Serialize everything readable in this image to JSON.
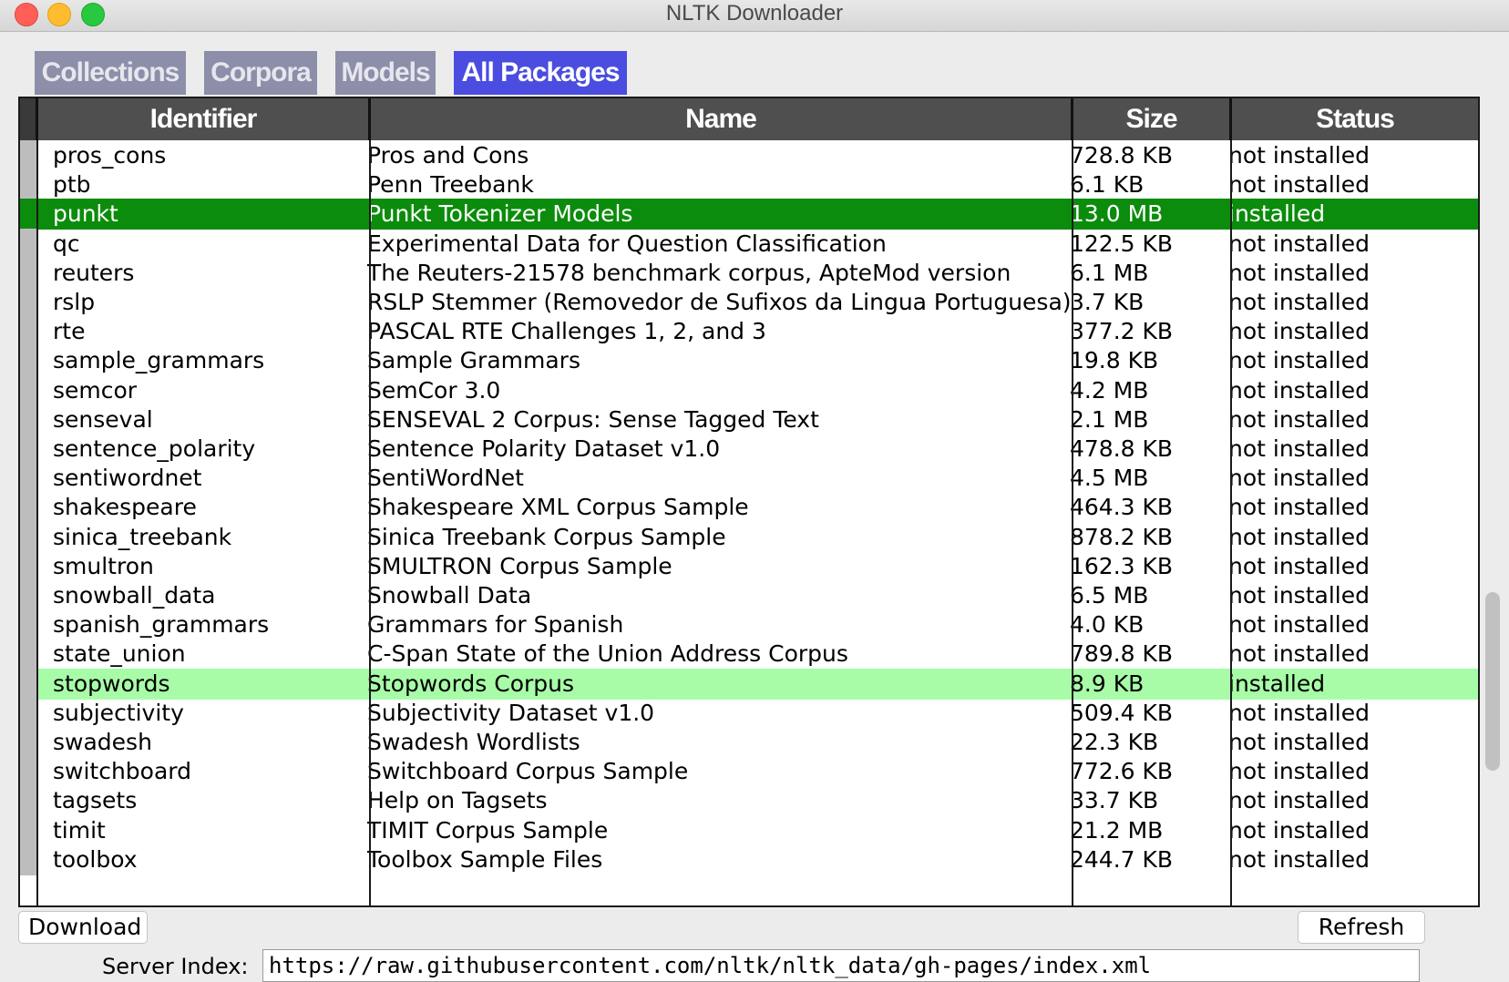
{
  "window": {
    "title": "NLTK Downloader"
  },
  "tabs": [
    {
      "label": "Collections",
      "active": false
    },
    {
      "label": "Corpora",
      "active": false
    },
    {
      "label": "Models",
      "active": false
    },
    {
      "label": "All Packages",
      "active": true
    }
  ],
  "table": {
    "columns": [
      "Identifier",
      "Name",
      "Size",
      "Status"
    ],
    "rows": [
      {
        "id": "pros_cons",
        "name": "Pros and Cons",
        "size": "728.8 KB",
        "status": "not installed",
        "hl": ""
      },
      {
        "id": "ptb",
        "name": "Penn Treebank",
        "size": "6.1 KB",
        "status": "not installed",
        "hl": ""
      },
      {
        "id": "punkt",
        "name": "Punkt Tokenizer Models",
        "size": "13.0 MB",
        "status": "installed",
        "hl": "green"
      },
      {
        "id": "qc",
        "name": "Experimental Data for Question Classification",
        "size": "122.5 KB",
        "status": "not installed",
        "hl": ""
      },
      {
        "id": "reuters",
        "name": "The Reuters-21578 benchmark corpus, ApteMod version",
        "size": "6.1 MB",
        "status": "not installed",
        "hl": ""
      },
      {
        "id": "rslp",
        "name": "RSLP Stemmer (Removedor de Sufixos da Lingua Portuguesa)",
        "size": "3.7 KB",
        "status": "not installed",
        "hl": ""
      },
      {
        "id": "rte",
        "name": "PASCAL RTE Challenges 1, 2, and 3",
        "size": "377.2 KB",
        "status": "not installed",
        "hl": ""
      },
      {
        "id": "sample_grammars",
        "name": "Sample Grammars",
        "size": "19.8 KB",
        "status": "not installed",
        "hl": ""
      },
      {
        "id": "semcor",
        "name": "SemCor 3.0",
        "size": "4.2 MB",
        "status": "not installed",
        "hl": ""
      },
      {
        "id": "senseval",
        "name": "SENSEVAL 2 Corpus: Sense Tagged Text",
        "size": "2.1 MB",
        "status": "not installed",
        "hl": ""
      },
      {
        "id": "sentence_polarity",
        "name": "Sentence Polarity Dataset v1.0",
        "size": "478.8 KB",
        "status": "not installed",
        "hl": ""
      },
      {
        "id": "sentiwordnet",
        "name": "SentiWordNet",
        "size": "4.5 MB",
        "status": "not installed",
        "hl": ""
      },
      {
        "id": "shakespeare",
        "name": "Shakespeare XML Corpus Sample",
        "size": "464.3 KB",
        "status": "not installed",
        "hl": ""
      },
      {
        "id": "sinica_treebank",
        "name": "Sinica Treebank Corpus Sample",
        "size": "878.2 KB",
        "status": "not installed",
        "hl": ""
      },
      {
        "id": "smultron",
        "name": "SMULTRON Corpus Sample",
        "size": "162.3 KB",
        "status": "not installed",
        "hl": ""
      },
      {
        "id": "snowball_data",
        "name": "Snowball Data",
        "size": "6.5 MB",
        "status": "not installed",
        "hl": ""
      },
      {
        "id": "spanish_grammars",
        "name": "Grammars for Spanish",
        "size": "4.0 KB",
        "status": "not installed",
        "hl": ""
      },
      {
        "id": "state_union",
        "name": "C-Span State of the Union Address Corpus",
        "size": "789.8 KB",
        "status": "not installed",
        "hl": ""
      },
      {
        "id": "stopwords",
        "name": "Stopwords Corpus",
        "size": "8.9 KB",
        "status": "installed",
        "hl": "lightgreen"
      },
      {
        "id": "subjectivity",
        "name": "Subjectivity Dataset v1.0",
        "size": "509.4 KB",
        "status": "not installed",
        "hl": ""
      },
      {
        "id": "swadesh",
        "name": "Swadesh Wordlists",
        "size": "22.3 KB",
        "status": "not installed",
        "hl": ""
      },
      {
        "id": "switchboard",
        "name": "Switchboard Corpus Sample",
        "size": "772.6 KB",
        "status": "not installed",
        "hl": ""
      },
      {
        "id": "tagsets",
        "name": "Help on Tagsets",
        "size": "33.7 KB",
        "status": "not installed",
        "hl": ""
      },
      {
        "id": "timit",
        "name": "TIMIT Corpus Sample",
        "size": "21.2 MB",
        "status": "not installed",
        "hl": ""
      },
      {
        "id": "toolbox",
        "name": "Toolbox Sample Files",
        "size": "244.7 KB",
        "status": "not installed",
        "hl": ""
      }
    ]
  },
  "buttons": {
    "download": "Download",
    "refresh": "Refresh"
  },
  "server": {
    "label": "Server Index:",
    "url": "https://raw.githubusercontent.com/nltk/nltk_data/gh-pages/index.xml"
  },
  "colors": {
    "installed_selected": "#0c8c0c",
    "installed": "#a8fca8",
    "tab_active": "#4a4de0",
    "tab_inactive": "#8d8ea9",
    "header": "#4f4f4f"
  }
}
